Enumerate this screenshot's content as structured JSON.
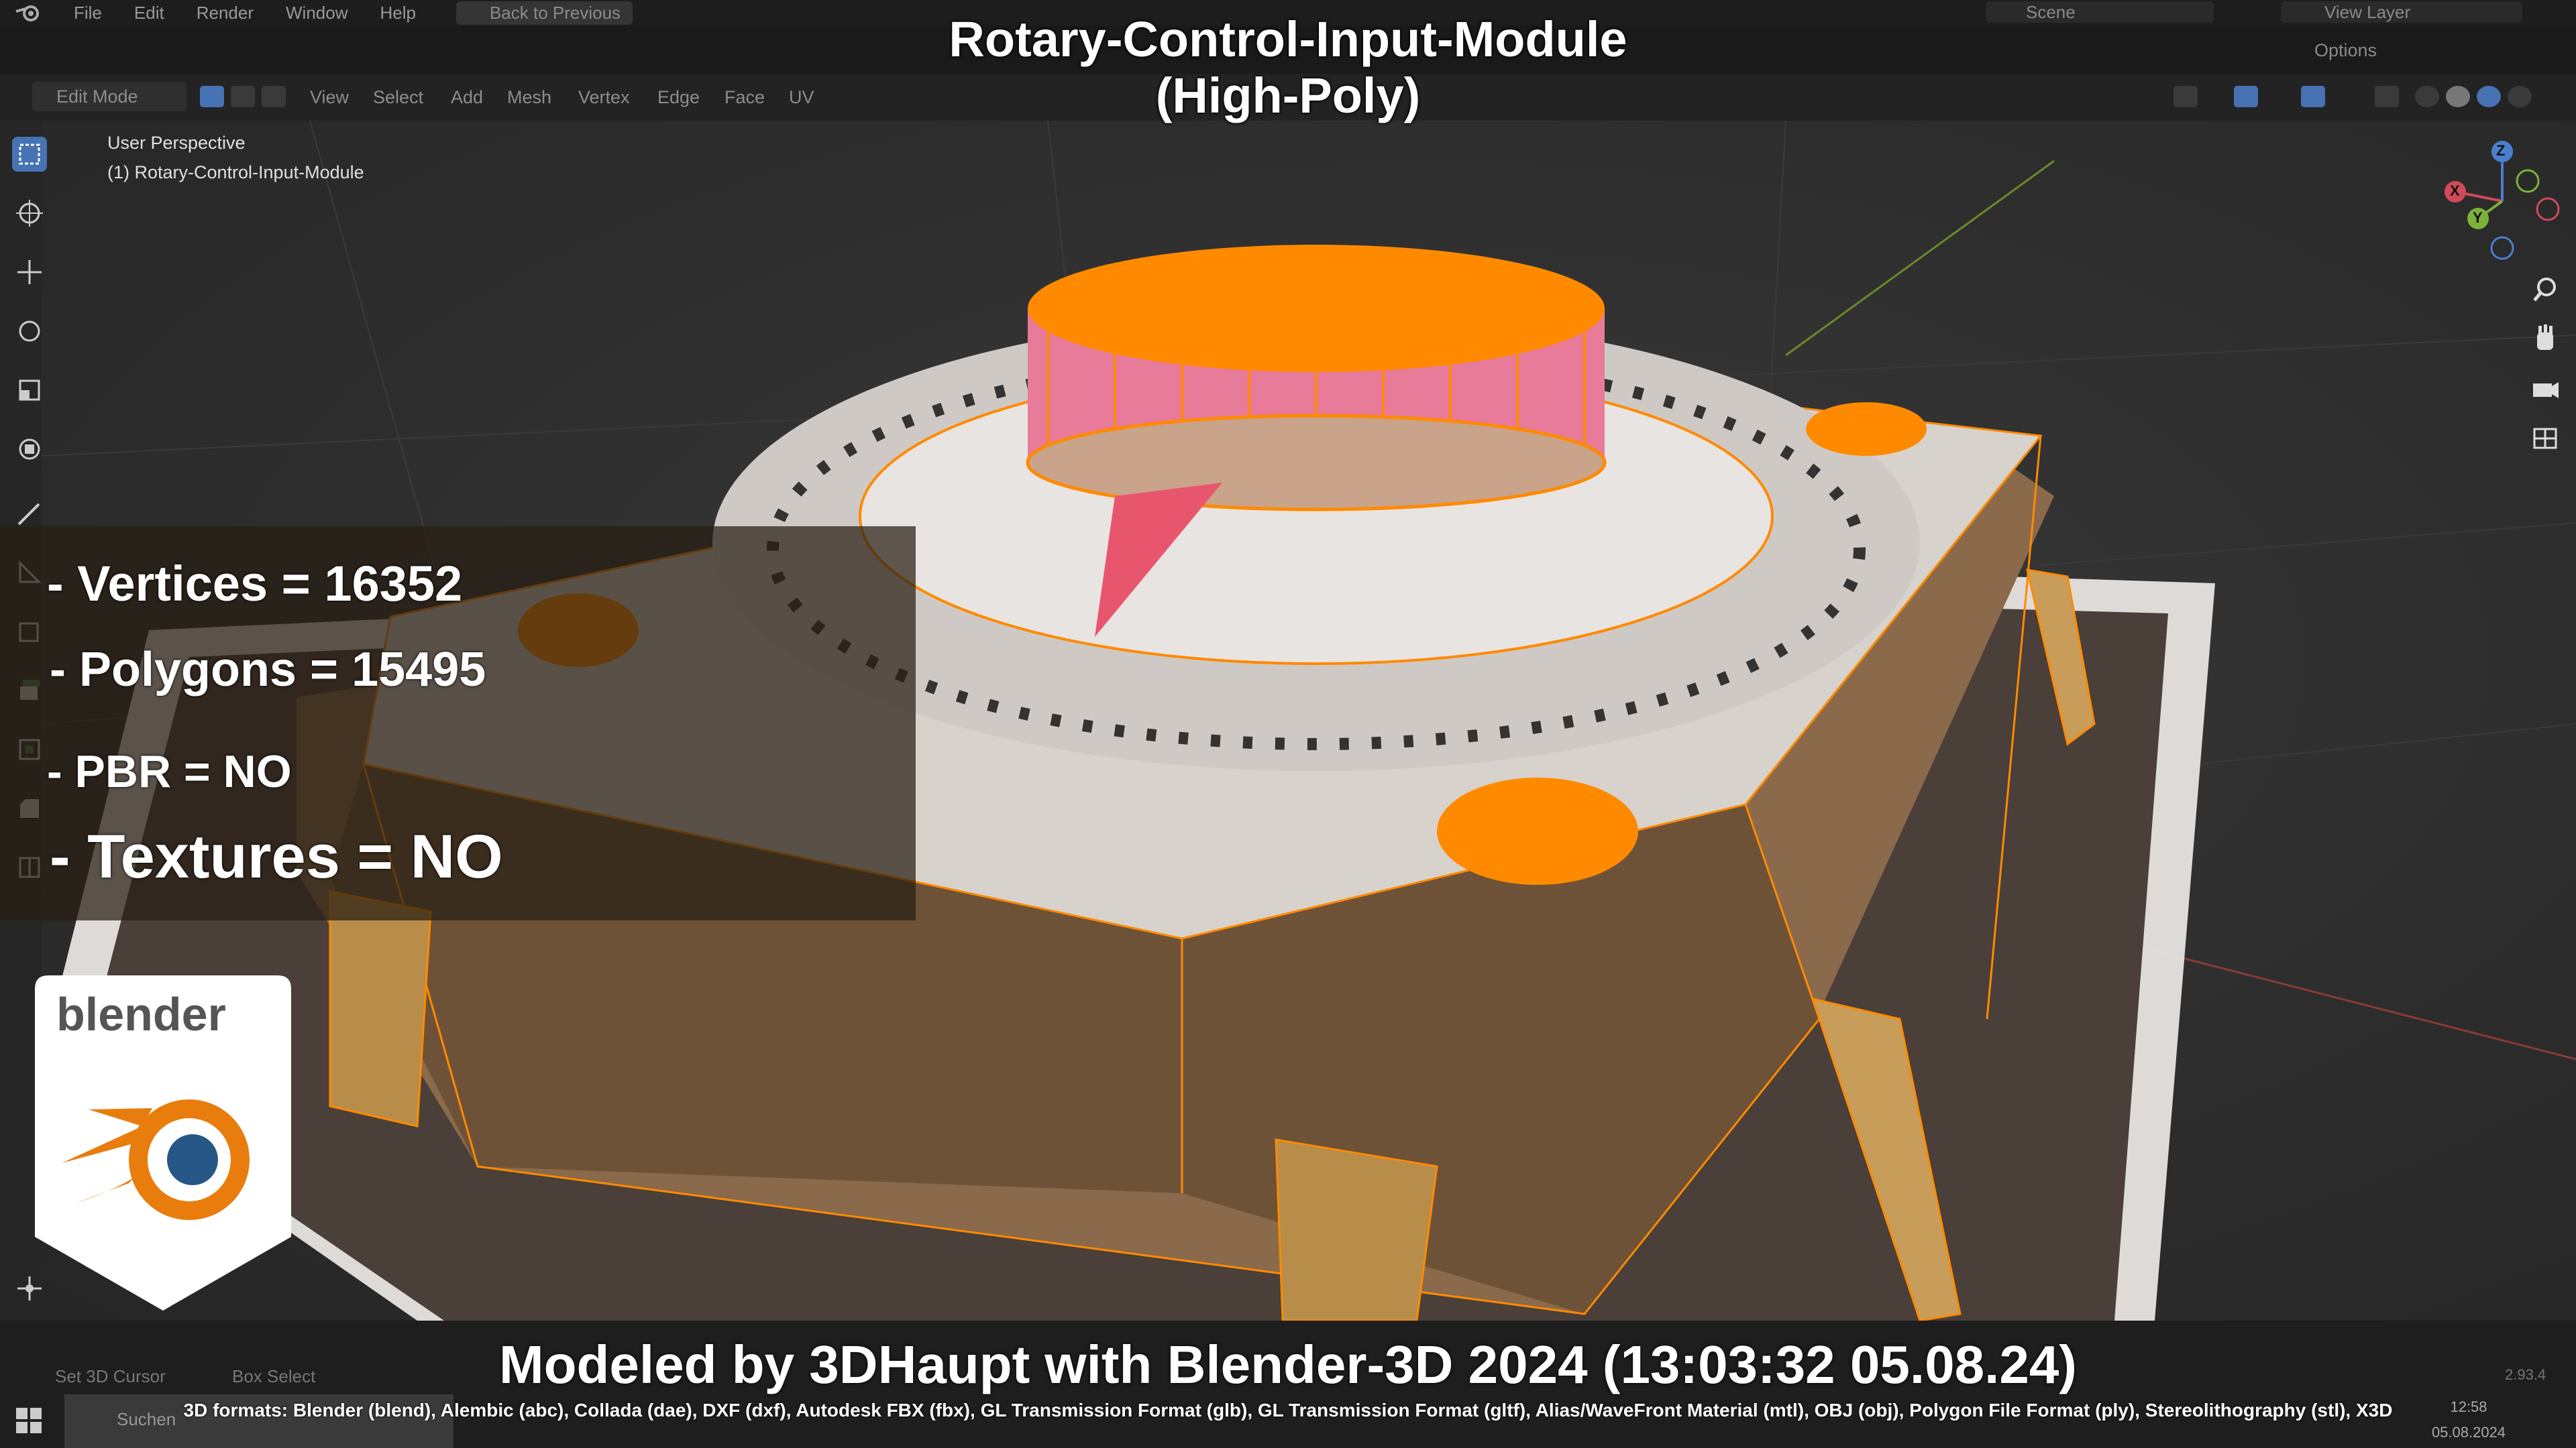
{
  "menubar": {
    "items": [
      "File",
      "Edit",
      "Render",
      "Window",
      "Help"
    ],
    "back_button": "Back to Previous",
    "scene": "Scene",
    "view_layer": "View Layer"
  },
  "header": {
    "mode": "Edit Mode",
    "menus": [
      "View",
      "Select",
      "Add",
      "Mesh",
      "Vertex",
      "Edge",
      "Face",
      "UV"
    ],
    "options": "Options",
    "axes": [
      "X",
      "Y",
      "Z"
    ]
  },
  "viewport": {
    "perspective": "User Perspective",
    "object": "(1) Rotary-Control-Input-Module"
  },
  "overlay": {
    "title_line1": "Rotary-Control-Input-Module",
    "title_line2": "(High-Poly)",
    "vertices": "- Vertices = 16352",
    "polygons": "- Polygons = 15495",
    "pbr": "- PBR =  NO",
    "textures": "- Textures = NO",
    "logo_text": "blender"
  },
  "footer": {
    "main": "Modeled by 3DHaupt with Blender-3D 2024 (13:03:32  05.08.24)",
    "formats": "3D formats: Blender (blend), Alembic (abc), Collada (dae), DXF (dxf), Autodesk FBX (fbx), GL Transmission Format (glb), GL Transmission Format (gltf), Alias/WaveFront Material (mtl), OBJ (obj), Polygon File Format (ply), Stereolithography (stl), X3D",
    "status_left": "Set 3D Cursor",
    "status_mid": "Box Select",
    "version": "2.93.4",
    "search": "Suchen",
    "clock_time": "12:58",
    "clock_date": "05.08.2024"
  },
  "gizmo": {
    "x": "X",
    "y": "Y",
    "z": "Z"
  },
  "colors": {
    "accent": "#4772b3",
    "selection": "#ff8a00",
    "blender_orange": "#e87d0d",
    "blender_blue": "#265787"
  },
  "icons": [
    "select-box-icon",
    "cursor-icon",
    "move-icon",
    "rotate-icon",
    "scale-icon",
    "transform-icon",
    "annotate-icon",
    "measure-icon",
    "add-cube-icon",
    "extrude-icon",
    "inset-icon",
    "bevel-icon",
    "loop-cut-icon",
    "zoom-icon",
    "hand-icon",
    "camera-icon",
    "grid-icon"
  ]
}
